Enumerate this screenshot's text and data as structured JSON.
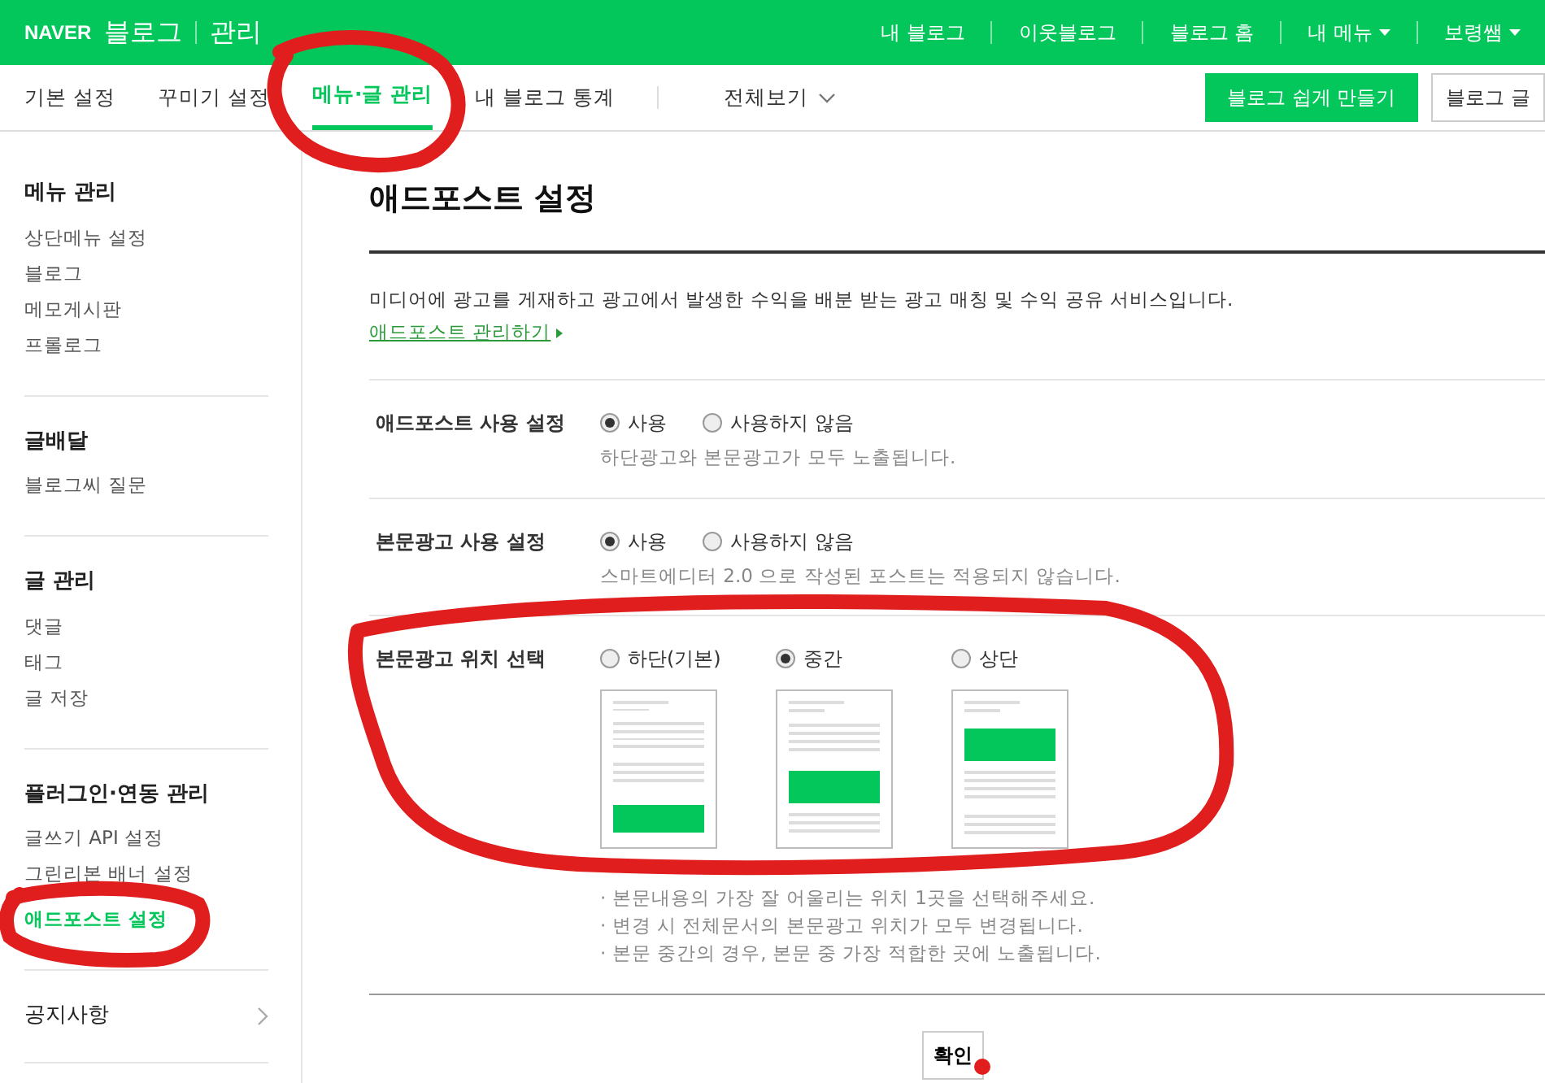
{
  "header": {
    "logo": "NAVER",
    "service": "블로그",
    "section": "관리",
    "links": [
      {
        "label": "내 블로그",
        "dropdown": false
      },
      {
        "label": "이웃블로그",
        "dropdown": false
      },
      {
        "label": "블로그 홈",
        "dropdown": false
      },
      {
        "label": "내 메뉴",
        "dropdown": true
      },
      {
        "label": "보령쌤",
        "dropdown": true
      }
    ]
  },
  "tabs": [
    {
      "label": "기본 설정",
      "selected": false,
      "dropdown": false
    },
    {
      "label": "꾸미기 설정",
      "selected": false,
      "dropdown": false
    },
    {
      "label": "메뉴·글 관리",
      "selected": true,
      "dropdown": false
    },
    {
      "label": "내 블로그 통계",
      "selected": false,
      "dropdown": false
    },
    {
      "label": "전체보기",
      "selected": false,
      "dropdown": true
    }
  ],
  "action_buttons": [
    {
      "label": "블로그 쉽게 만들기",
      "kind": "primary"
    },
    {
      "label": "블로그 글",
      "kind": "outline"
    }
  ],
  "sidebar": {
    "groups": [
      {
        "title": "메뉴 관리",
        "items": [
          {
            "label": "상단메뉴 설정",
            "selected": false
          },
          {
            "label": "블로그",
            "selected": false
          },
          {
            "label": "메모게시판",
            "selected": false
          },
          {
            "label": "프롤로그",
            "selected": false
          }
        ]
      },
      {
        "title": "글배달",
        "items": [
          {
            "label": "블로그씨 질문",
            "selected": false
          }
        ]
      },
      {
        "title": "글 관리",
        "items": [
          {
            "label": "댓글",
            "selected": false
          },
          {
            "label": "태그",
            "selected": false
          },
          {
            "label": "글 저장",
            "selected": false
          }
        ]
      },
      {
        "title": "플러그인·연동 관리",
        "items": [
          {
            "label": "글쓰기 API 설정",
            "selected": false
          },
          {
            "label": "그린리본 배너 설정",
            "selected": false
          },
          {
            "label": "애드포스트 설정",
            "selected": true
          }
        ]
      }
    ],
    "links": [
      {
        "label": "공지사항"
      }
    ]
  },
  "page": {
    "title": "애드포스트 설정",
    "description": "미디어에 광고를 게재하고 광고에서 발생한 수익을 배분 받는 광고 매칭 및 수익 공유 서비스입니다.",
    "manage_link": "애드포스트 관리하기"
  },
  "settings": [
    {
      "label": "애드포스트 사용 설정",
      "options": [
        {
          "label": "사용",
          "selected": true
        },
        {
          "label": "사용하지 않음",
          "selected": false
        }
      ],
      "hint": "하단광고와 본문광고가 모두 노출됩니다."
    },
    {
      "label": "본문광고 사용 설정",
      "options": [
        {
          "label": "사용",
          "selected": true
        },
        {
          "label": "사용하지 않음",
          "selected": false
        }
      ],
      "hint": "스마트에디터 2.0 으로 작성된 포스트는 적용되지 않습니다."
    },
    {
      "label": "본문광고 위치 선택",
      "options": [
        {
          "label": "하단(기본)",
          "selected": false,
          "kind": "bottom"
        },
        {
          "label": "중간",
          "selected": true,
          "kind": "middle"
        },
        {
          "label": "상단",
          "selected": false,
          "kind": "top"
        }
      ],
      "notes": [
        "· 본문내용의 가장 잘 어울리는 위치 1곳을 선택해주세요.",
        "· 변경 시 전체문서의 본문광고 위치가 모두 변경됩니다.",
        "· 본문 중간의 경우, 본문 중 가장 적합한 곳에 노출됩니다."
      ]
    }
  ],
  "confirm_button": "확인",
  "annotations": [
    {
      "kind": "tab-loop",
      "color": "#e01e1e"
    },
    {
      "kind": "sidebar-loop",
      "color": "#e01e1e"
    },
    {
      "kind": "section-loop",
      "color": "#e01e1e"
    },
    {
      "kind": "dot",
      "color": "#e01e1e"
    }
  ]
}
